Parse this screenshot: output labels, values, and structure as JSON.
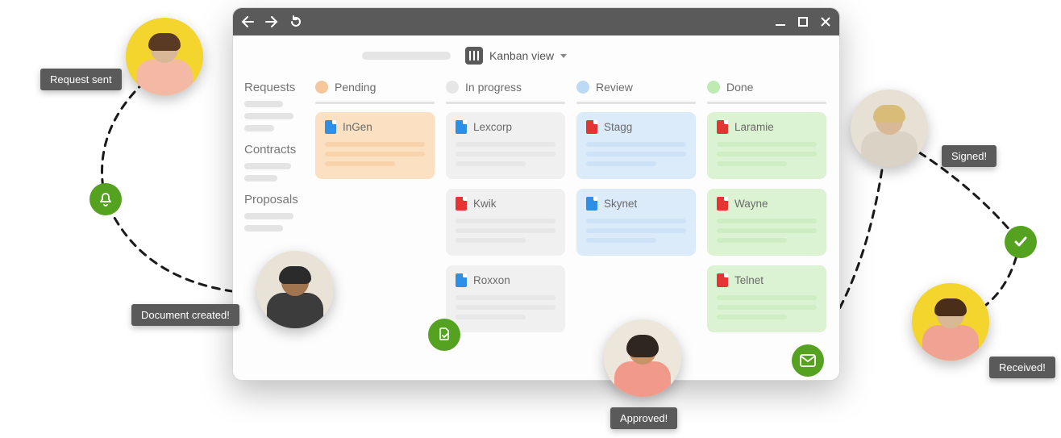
{
  "view_switcher": {
    "label": "Kanban view"
  },
  "sidebar": {
    "groups": [
      {
        "title": "Requests"
      },
      {
        "title": "Contracts"
      },
      {
        "title": "Proposals"
      }
    ]
  },
  "columns": [
    {
      "name": "Pending",
      "dot": "#f6c79a",
      "card_bg": "#fbe0c1",
      "line": "#f7cda2",
      "cards": [
        {
          "title": "InGen",
          "file": "blue"
        }
      ]
    },
    {
      "name": "In progress",
      "dot": "#e6e6e6",
      "card_bg": "#f0f0f0",
      "line": "#e2e2e2",
      "cards": [
        {
          "title": "Lexcorp",
          "file": "blue"
        },
        {
          "title": "Kwik",
          "file": "red"
        },
        {
          "title": "Roxxon",
          "file": "blue"
        }
      ]
    },
    {
      "name": "Review",
      "dot": "#bcd9f6",
      "card_bg": "#dcebfa",
      "line": "#c5ddf4",
      "cards": [
        {
          "title": "Stagg",
          "file": "red"
        },
        {
          "title": "Skynet",
          "file": "blue"
        }
      ]
    },
    {
      "name": "Done",
      "dot": "#bfeab2",
      "card_bg": "#dcf3d3",
      "line": "#c6e9b9",
      "cards": [
        {
          "title": "Laramie",
          "file": "red"
        },
        {
          "title": "Wayne",
          "file": "red"
        },
        {
          "title": "Telnet",
          "file": "red"
        }
      ]
    }
  ],
  "badges": {
    "request_sent": "Request sent",
    "doc_created": "Document created!",
    "approved": "Approved!",
    "signed": "Signed!",
    "received": "Received!"
  },
  "colors": {
    "accent_green": "#54a220",
    "titlebar": "#5a5a5a"
  }
}
